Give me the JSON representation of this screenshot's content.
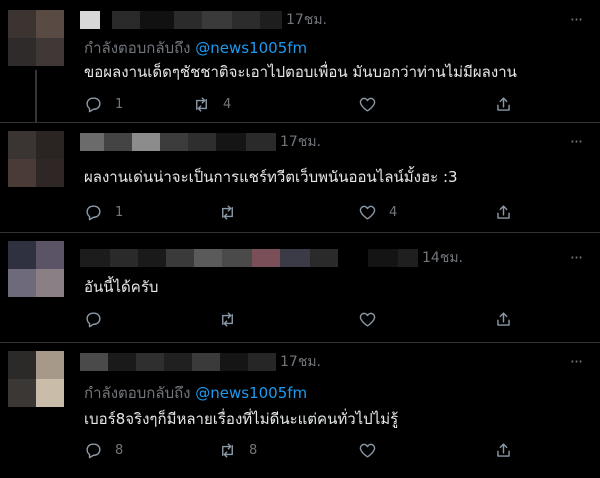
{
  "tweets": [
    {
      "time": "17ชม.",
      "reply_prefix": "กำลังตอบกลับถึง",
      "reply_handle": "@news1005fm",
      "text": "ขอผลงานเด็ดๆชัชชาติจะเอาไปตอบเพื่อน มันบอกว่าท่านไม่มีผลงาน",
      "reply_count": "1",
      "retweet_count": "4",
      "like_count": ""
    },
    {
      "time": "17ชม.",
      "reply_prefix": "",
      "reply_handle": "",
      "text": "ผลงานเด่นน่าจะเป็นการแชร์ทวีตเว็บพนันออนไลน์มั้งฮะ :3",
      "reply_count": "1",
      "retweet_count": "",
      "like_count": "4"
    },
    {
      "time": "14ชม.",
      "reply_prefix": "",
      "reply_handle": "",
      "text": "อันนี้ได้ครับ",
      "reply_count": "",
      "retweet_count": "",
      "like_count": ""
    },
    {
      "time": "17ชม.",
      "reply_prefix": "กำลังตอบกลับถึง",
      "reply_handle": "@news1005fm",
      "text": "เบอร์8จริงๆก็มีหลายเรื่องที่ไม่ดีนะแต่คนทั่วไปไม่รู้",
      "reply_count": "8",
      "retweet_count": "8",
      "like_count": ""
    }
  ],
  "colors": {
    "background": "#000000",
    "text": "#e7e9ea",
    "muted": "#71767b",
    "link": "#1d9bf0",
    "divider": "#2f3336"
  },
  "icons": [
    "reply-icon",
    "retweet-icon",
    "like-icon",
    "share-icon",
    "more-icon"
  ]
}
